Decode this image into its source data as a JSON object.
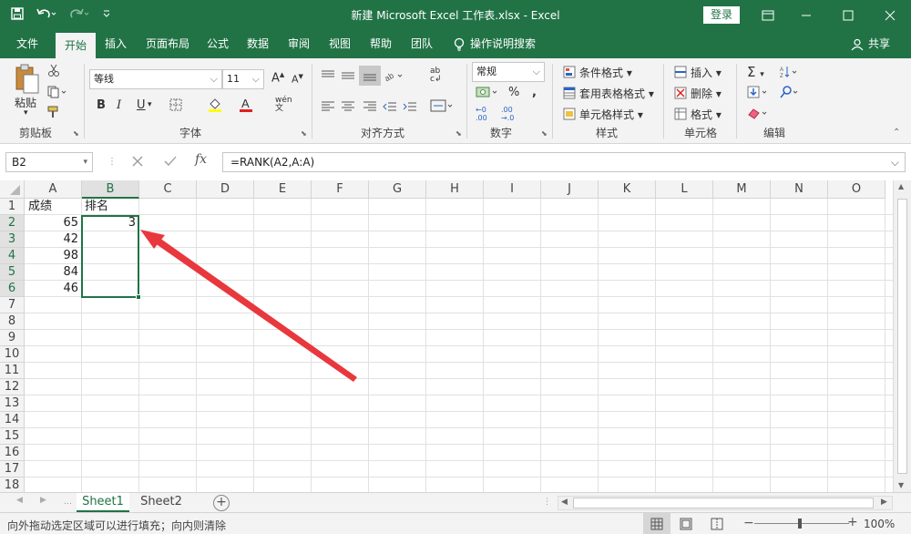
{
  "window": {
    "title": "新建 Microsoft Excel 工作表.xlsx  -  Excel",
    "login_label": "登录"
  },
  "qat": {
    "icons": [
      "save-icon",
      "undo-icon",
      "redo-icon",
      "customize-icon"
    ]
  },
  "ribbon_tabs": [
    "文件",
    "开始",
    "插入",
    "页面布局",
    "公式",
    "数据",
    "审阅",
    "视图",
    "帮助",
    "团队"
  ],
  "active_tab": "开始",
  "tell_me": "操作说明搜索",
  "share_label": "共享",
  "ribbon": {
    "clipboard": {
      "label": "剪贴板",
      "paste": "粘贴"
    },
    "font": {
      "label": "字体",
      "name": "等线",
      "size": "11"
    },
    "alignment": {
      "label": "对齐方式"
    },
    "number": {
      "label": "数字",
      "format": "常规"
    },
    "styles": {
      "label": "样式",
      "conditional": "条件格式",
      "table": "套用表格格式",
      "cell_styles": "单元格样式"
    },
    "cells": {
      "label": "单元格",
      "insert": "插入",
      "delete": "删除",
      "format": "格式"
    },
    "editing": {
      "label": "编辑"
    }
  },
  "formula_bar": {
    "name_box": "B2",
    "formula": "=RANK(A2,A:A)"
  },
  "columns": [
    "A",
    "B",
    "C",
    "D",
    "E",
    "F",
    "G",
    "H",
    "I",
    "J",
    "K",
    "L",
    "M",
    "N",
    "O"
  ],
  "rows": [
    "1",
    "2",
    "3",
    "4",
    "5",
    "6",
    "7",
    "8",
    "9",
    "10",
    "11",
    "12",
    "13",
    "14",
    "15",
    "16",
    "17",
    "18"
  ],
  "cells": {
    "A1": "成绩",
    "B1": "排名",
    "A2": "65",
    "B2": "3",
    "A3": "42",
    "A4": "98",
    "A5": "84",
    "A6": "46"
  },
  "selection": {
    "active": "B2",
    "range": "B2:B6"
  },
  "sheets": [
    "Sheet1",
    "Sheet2"
  ],
  "active_sheet": "Sheet1",
  "status": {
    "message": "向外拖动选定区域可以进行填充；向内则清除",
    "zoom": "100%"
  },
  "colors": {
    "accent": "#217346",
    "annotation_arrow": "#e8383d"
  }
}
